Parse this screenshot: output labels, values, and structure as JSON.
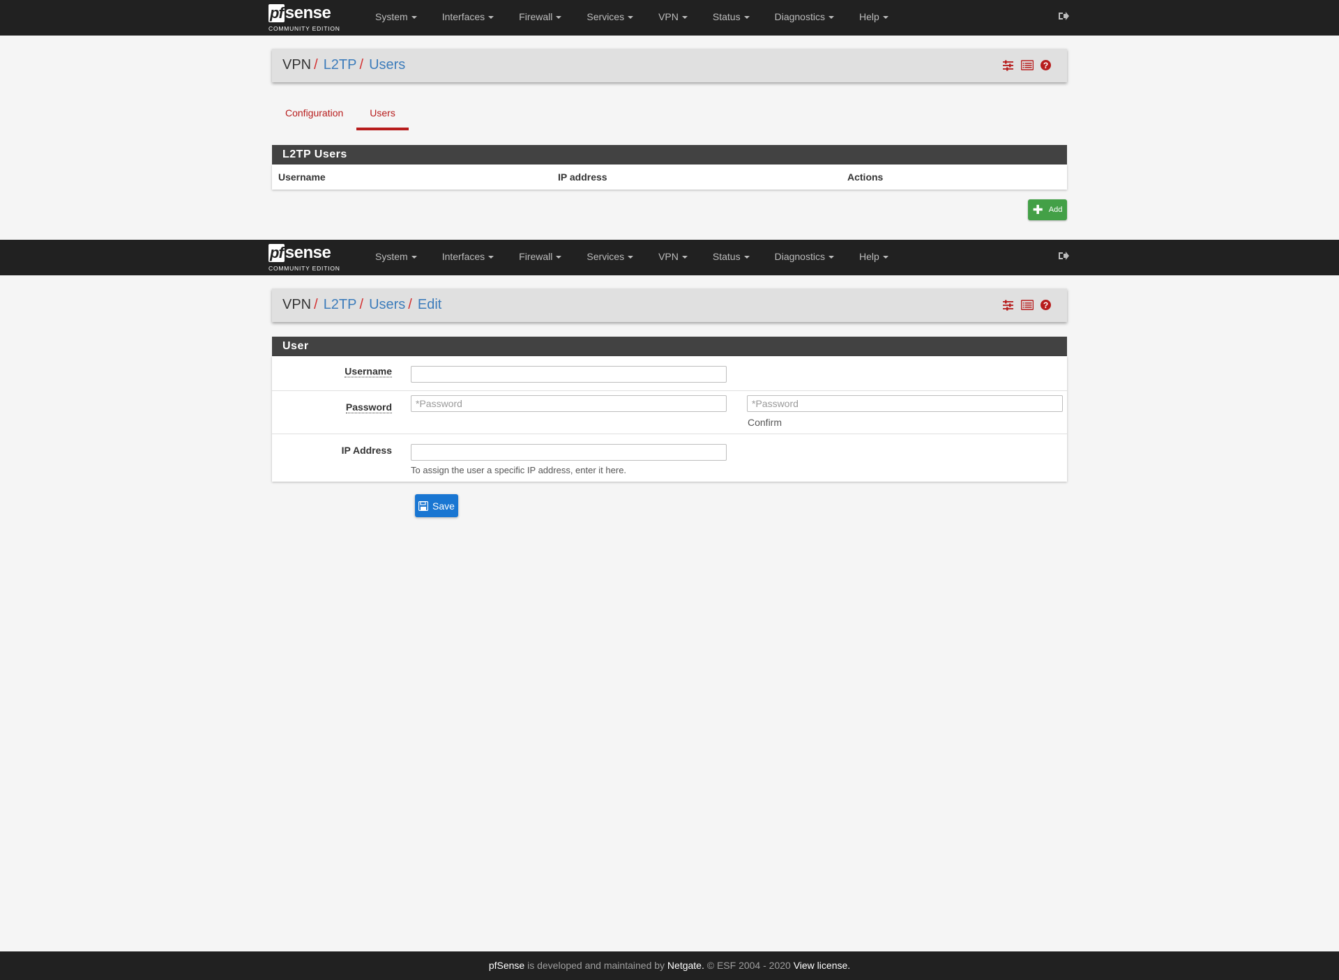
{
  "brand": {
    "logo_pf": "pf",
    "logo_sense": "sense",
    "edition": "COMMUNITY EDITION"
  },
  "nav": {
    "items": [
      {
        "label": "System"
      },
      {
        "label": "Interfaces"
      },
      {
        "label": "Firewall"
      },
      {
        "label": "Services"
      },
      {
        "label": "VPN"
      },
      {
        "label": "Status"
      },
      {
        "label": "Diagnostics"
      },
      {
        "label": "Help"
      }
    ],
    "logout_icon": "sign-out-icon"
  },
  "page1": {
    "breadcrumb": [
      "VPN",
      "L2TP",
      "Users"
    ],
    "breadcrumb_sep": "/",
    "tabs": [
      {
        "label": "Configuration",
        "active": false
      },
      {
        "label": "Users",
        "active": true
      }
    ],
    "panel_title": "L2TP Users",
    "columns": [
      "Username",
      "IP address",
      "Actions"
    ],
    "add_label": "Add"
  },
  "page2": {
    "breadcrumb": [
      "VPN",
      "L2TP",
      "Users",
      "Edit"
    ],
    "breadcrumb_sep": "/",
    "panel_title": "User",
    "fields": {
      "username": {
        "label": "Username",
        "value": ""
      },
      "password": {
        "label": "Password",
        "placeholder": "*Password",
        "confirm_placeholder": "*Password",
        "confirm_label": "Confirm"
      },
      "ip": {
        "label": "IP Address",
        "value": "",
        "help": "To assign the user a specific IP address, enter it here."
      }
    },
    "save_label": "Save"
  },
  "header_icons": [
    "sliders-icon",
    "list-icon",
    "question-circle-icon"
  ],
  "footer": {
    "brand": "pfSense",
    "text1": " is developed and maintained by ",
    "company": "Netgate.",
    "text2": " © ESF 2004 - 2020 ",
    "license": "View license."
  },
  "colors": {
    "navbar": "#212121",
    "accent_red": "#b71c1c",
    "link_blue": "#3c7cbb",
    "add_green": "#43a047",
    "save_blue": "#1976d2"
  }
}
